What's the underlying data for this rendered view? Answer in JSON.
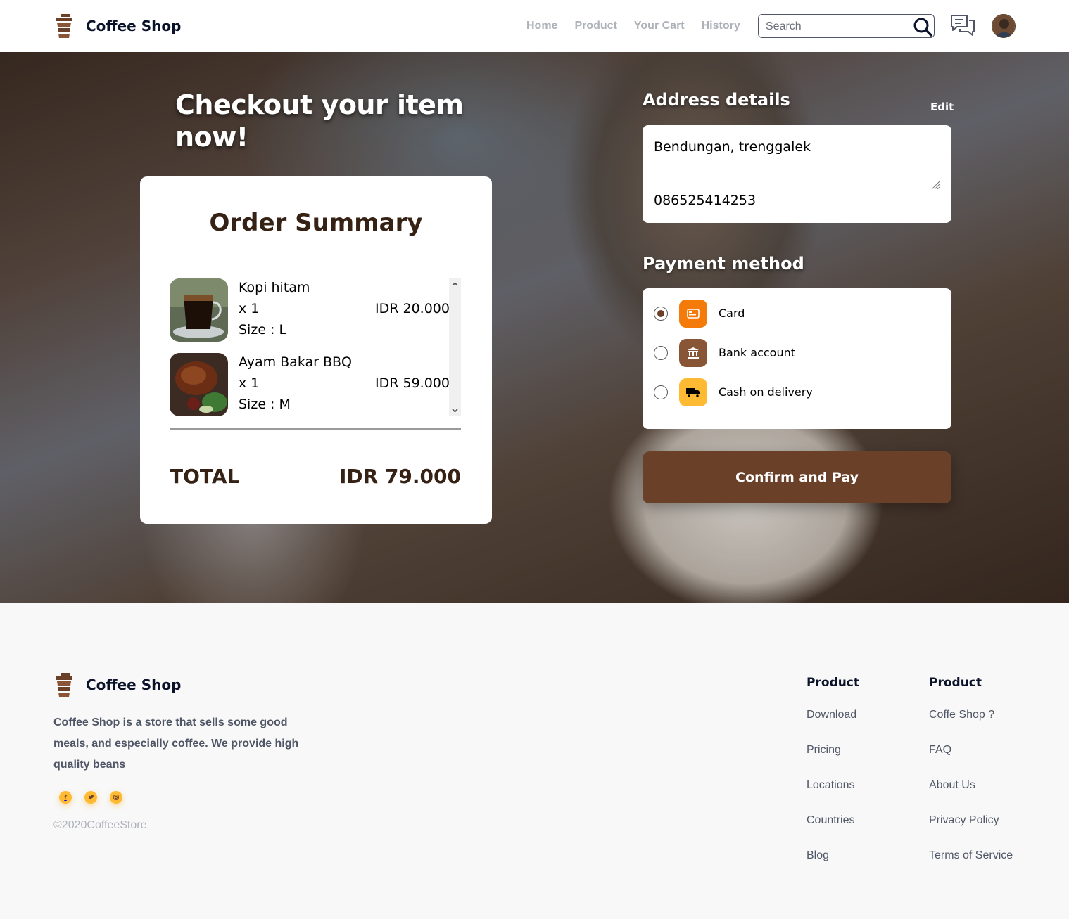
{
  "navbar": {
    "brand": "Coffee Shop",
    "links": [
      "Home",
      "Product",
      "Your Cart",
      "History"
    ],
    "search_placeholder": "Search"
  },
  "hero": {
    "title": "Checkout your item now!"
  },
  "order_summary": {
    "title": "Order Summary",
    "items": [
      {
        "name": "Kopi hitam",
        "qty": "x 1",
        "size": "Size : L",
        "price": "IDR 20.000"
      },
      {
        "name": "Ayam Bakar BBQ",
        "qty": "x 1",
        "size": "Size : M",
        "price": "IDR 59.000"
      }
    ],
    "total_label": "TOTAL",
    "total_value": "IDR 79.000"
  },
  "address": {
    "heading": "Address details",
    "edit_label": "Edit",
    "address_line": "Bendungan, trenggalek",
    "phone": "086525414253"
  },
  "payment": {
    "heading": "Payment method",
    "options": [
      {
        "label": "Card",
        "icon": "card-icon",
        "color": "#f47b0a",
        "selected": true
      },
      {
        "label": "Bank account",
        "icon": "bank-icon",
        "color": "#895537",
        "selected": false
      },
      {
        "label": "Cash on delivery",
        "icon": "truck-icon",
        "color": "#ffba33",
        "selected": false
      }
    ],
    "confirm_label": "Confirm and Pay"
  },
  "footer": {
    "brand": "Coffee Shop",
    "description": "Coffee Shop is a store that sells some good meals, and especially coffee. We provide high quality beans",
    "socials": [
      "facebook-icon",
      "twitter-icon",
      "instagram-icon"
    ],
    "copyright": "©2020CoffeeStore",
    "columns": [
      {
        "heading": "Product",
        "links": [
          "Download",
          "Pricing",
          "Locations",
          "Countries",
          "Blog"
        ]
      },
      {
        "heading": "Product",
        "links": [
          "Coffe Shop ?",
          "FAQ",
          "About Us",
          "Privacy Policy",
          "Terms of Service"
        ]
      }
    ]
  },
  "colors": {
    "brand_brown": "#6a4029",
    "dark_brown": "#362115",
    "accent_yellow": "#ffba33",
    "nav_text": "#aeb2b8"
  }
}
